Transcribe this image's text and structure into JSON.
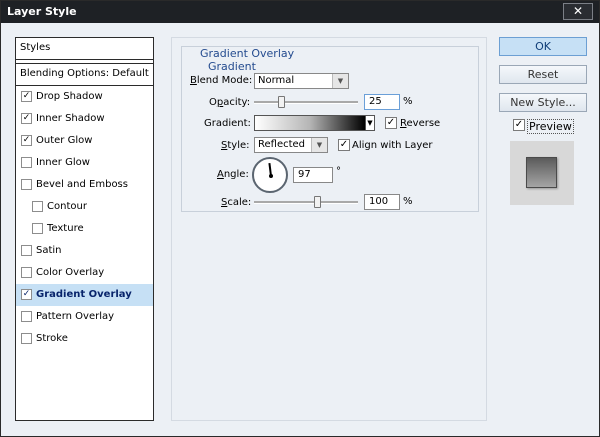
{
  "window": {
    "title": "Layer Style",
    "close_glyph": "✕"
  },
  "styles_panel": {
    "header": "Styles",
    "blending_options": "Blending Options: Default",
    "items": [
      {
        "label": "Drop Shadow",
        "checked": true
      },
      {
        "label": "Inner Shadow",
        "checked": true
      },
      {
        "label": "Outer Glow",
        "checked": true
      },
      {
        "label": "Inner Glow",
        "checked": false
      },
      {
        "label": "Bevel and Emboss",
        "checked": false
      },
      {
        "label": "Contour",
        "checked": false
      },
      {
        "label": "Texture",
        "checked": false
      },
      {
        "label": "Satin",
        "checked": false
      },
      {
        "label": "Color Overlay",
        "checked": false
      },
      {
        "label": "Gradient Overlay",
        "checked": true
      },
      {
        "label": "Pattern Overlay",
        "checked": false
      },
      {
        "label": "Stroke",
        "checked": false
      }
    ],
    "selected": "Gradient Overlay"
  },
  "gradient_overlay": {
    "group_title": "Gradient Overlay",
    "group_subtitle": "Gradient",
    "blend_mode": {
      "label_u": "B",
      "label_rest": "lend Mode:",
      "value": "Normal"
    },
    "opacity": {
      "label_pre": "O",
      "label_u": "p",
      "label_rest": "acity:",
      "value": "25",
      "unit": "%"
    },
    "gradient": {
      "label": "Gradient:",
      "reverse_label": "Reverse",
      "reverse_u": "R",
      "reverse_checked": true
    },
    "style": {
      "label_u": "S",
      "label_rest": "tyle:",
      "value": "Reflected",
      "align_label": "Align with Layer",
      "align_checked": true
    },
    "angle": {
      "label_pre": "",
      "label_u": "A",
      "label_rest": "ngle:",
      "value": "97",
      "unit": "°"
    },
    "scale": {
      "label_u": "S",
      "label_rest": "cale:",
      "value": "100",
      "unit": "%"
    }
  },
  "buttons": {
    "ok": "OK",
    "reset": "Reset",
    "new_style": "New Style...",
    "preview_label": "Preview",
    "preview_checked": true
  },
  "colors": {
    "titlebar": "#1e2125",
    "selected_bg": "#c6e0f5",
    "accent_text": "#244b8f"
  }
}
